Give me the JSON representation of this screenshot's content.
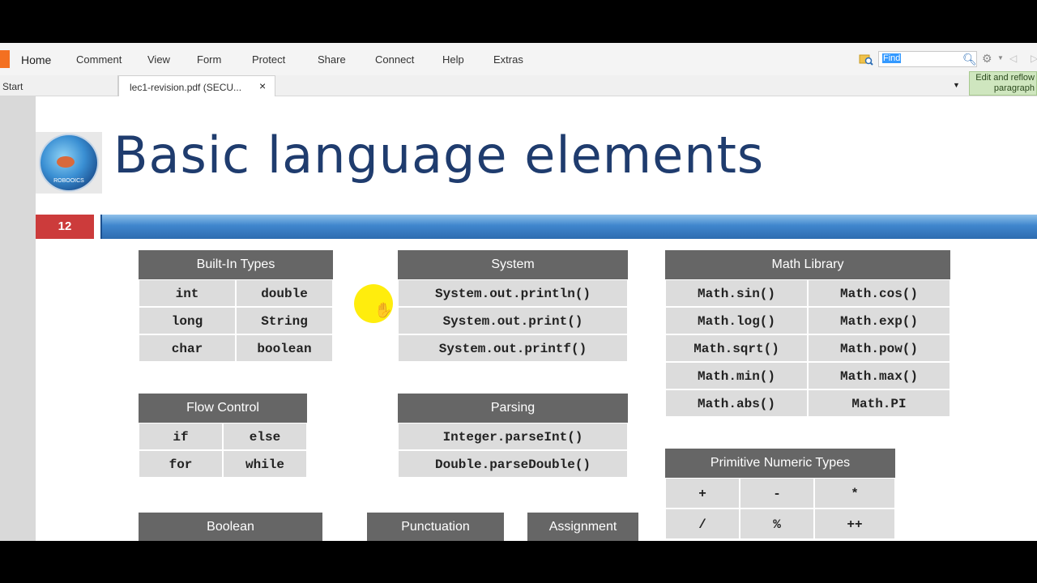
{
  "ribbon": {
    "menu": [
      "Home",
      "Comment",
      "View",
      "Form",
      "Protect",
      "Share",
      "Connect",
      "Help",
      "Extras"
    ],
    "find_value": "Find",
    "reflow_label_1": "Edit and reflow",
    "reflow_label_2": "paragraph"
  },
  "tabs": {
    "start": "Start",
    "document": "lec1-revision.pdf (SECU...",
    "close": "×"
  },
  "slide": {
    "logo_text": "ROBOOICS",
    "title": "Basic language elements",
    "number": "12"
  },
  "tables": {
    "builtin": {
      "title": "Built-In Types",
      "rows": [
        [
          "int",
          "double"
        ],
        [
          "long",
          "String"
        ],
        [
          "char",
          "boolean"
        ]
      ]
    },
    "system": {
      "title": "System",
      "rows": [
        "System.out.println()",
        "System.out.print()",
        "System.out.printf()"
      ]
    },
    "math": {
      "title": "Math Library",
      "rows": [
        [
          "Math.sin()",
          "Math.cos()"
        ],
        [
          "Math.log()",
          "Math.exp()"
        ],
        [
          "Math.sqrt()",
          "Math.pow()"
        ],
        [
          "Math.min()",
          "Math.max()"
        ],
        [
          "Math.abs()",
          "Math.PI"
        ]
      ]
    },
    "flow": {
      "title": "Flow Control",
      "rows": [
        [
          "if",
          "else"
        ],
        [
          "for",
          "while"
        ]
      ]
    },
    "parsing": {
      "title": "Parsing",
      "rows": [
        "Integer.parseInt()",
        "Double.parseDouble()"
      ]
    },
    "primitive": {
      "title": "Primitive Numeric Types",
      "rows": [
        [
          "+",
          "-",
          "*"
        ],
        [
          "/",
          "%",
          "++"
        ]
      ]
    },
    "boolean": {
      "title": "Boolean"
    },
    "punctuation": {
      "title": "Punctuation"
    },
    "assignment": {
      "title": "Assignment"
    }
  }
}
